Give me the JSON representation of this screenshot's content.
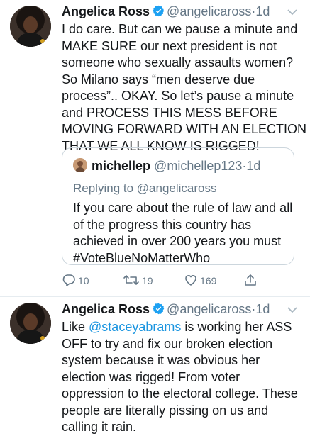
{
  "tweet1": {
    "name": "Angelica Ross",
    "handle": "@angelicaross",
    "separator": "·",
    "time": "1d",
    "lines": [
      "I do care.  But can we pause a minute and",
      "MAKE SURE our next president is not",
      "someone who sexually assaults women?",
      "So Milano says “men deserve due",
      "process”..  OKAY.  So let’s pause a minute",
      "and PROCESS THIS MESS BEFORE",
      "MOVING FORWARD WITH AN ELECTION",
      "THAT WE ALL KNOW IS RIGGED!"
    ],
    "quote": {
      "name": "michellep",
      "handle": "@michellep123",
      "separator": "·",
      "time": "1d",
      "replying_label": "Replying to",
      "replying_handle": "@angelicaross",
      "lines": [
        "If you care about the rule of law and all",
        "of the progress this country has",
        "achieved in over 200 years you must",
        "#VoteBlueNoMatterWho"
      ]
    },
    "actions": {
      "reply_count": "10",
      "retweet_count": "19",
      "like_count": "169"
    }
  },
  "tweet2": {
    "name": "Angelica Ross",
    "handle": "@angelicaross",
    "separator": "·",
    "time": "1d",
    "line1_prefix": "Like ",
    "line1_mention": "@staceyabrams",
    "line1_suffix": " is working her ASS",
    "lines": [
      "OFF to try and fix our broken election",
      "system because it was obvious her",
      "election was rigged!  From voter",
      "oppression to the electoral college.  These",
      "people are literally pissing on us and",
      "calling it rain."
    ]
  },
  "colors": {
    "text": "#14171a",
    "muted": "#657786",
    "link": "#1b95e0",
    "verified": "#1da1f2",
    "border": "#ccd6dd"
  },
  "icons": {
    "verified": "verified-badge-icon",
    "menu": "chevron-down-icon",
    "reply": "reply-icon",
    "retweet": "retweet-icon",
    "like": "heart-icon",
    "share": "share-icon"
  }
}
